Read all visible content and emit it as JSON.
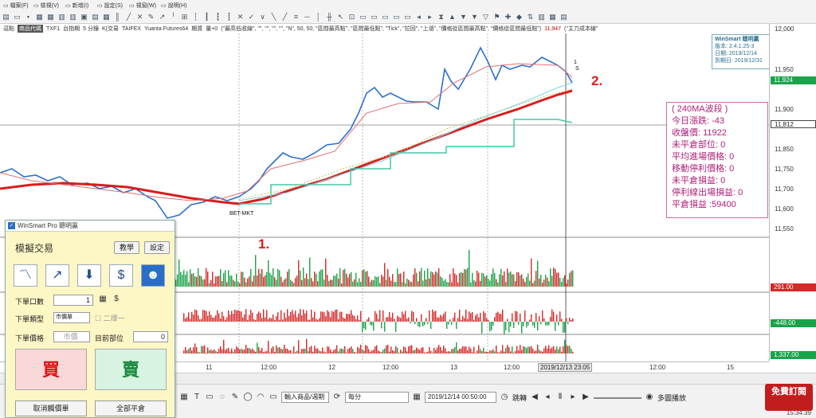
{
  "menu": [
    {
      "label": "檔案(F)",
      "icon": "file-icon"
    },
    {
      "label": "檢視(V)",
      "icon": "view-icon"
    },
    {
      "label": "新增(I)",
      "icon": "new-icon"
    },
    {
      "label": "設定(S)",
      "icon": "settings-icon"
    },
    {
      "label": "視窗(W)",
      "icon": "window-icon"
    },
    {
      "label": "說明(H)",
      "icon": "help-icon"
    }
  ],
  "infobar": {
    "prefix": "逗點",
    "chip": "商品代碼",
    "symbol": "TXF1",
    "exchange": "台指期",
    "period": "5 分鐘",
    "chart_type": "K(交易",
    "exchange_code": "TAIFEX",
    "source": "Yuanta Futures64",
    "contract": "期貨",
    "volume": "量+0",
    "indicators": "(\"最高低收線\", \"\", \"\", \"\", \"\", \"N\", 50, 50, \"區間最高點\", \"區間最低點\", \"Tick\", \"拉回\", \"上漲\", \"價格從區間最高點\", \"價格從區間最低點\")",
    "last": "11,947",
    "extra": "(\"主力成本線\""
  },
  "price_axis": {
    "ticks": [
      "12,000",
      "11,950",
      "11,900",
      "11,850",
      "11,800",
      "11,750",
      "11,700",
      "11,650",
      "11,600",
      "11,550"
    ],
    "flag_last": "11,924",
    "flag_cursor": "11,812",
    "sub1_flag": "291.00",
    "sub2_flag": "-448.00",
    "sub3_flag": "1,337.00"
  },
  "time_axis": {
    "labels": [
      "11",
      "12:00",
      "12",
      "12:00",
      "13",
      "12:00",
      "12:00",
      "15"
    ],
    "cursor": "2019/12/13 23:05"
  },
  "stat_box": {
    "title": "( 240MA波段 )",
    "rows": [
      "今日漲跌: -43",
      "收盤價: 11922",
      "未平倉部位: 0",
      "平均進場價格: 0",
      "移動停利價格: 0",
      "未平倉損益: 0",
      "停利線出場損益: 0",
      "平倉損益 :59400"
    ]
  },
  "ws_box": {
    "title": "WinSmart 聰明贏",
    "lines": [
      "版本: 2.4.1.25-3",
      "日期: 2019/12/14",
      "到期日: 2019/12/31"
    ]
  },
  "annotations": {
    "a1": "1.",
    "a2": "2."
  },
  "chart_labels": {
    "entry": "BET-MKT",
    "marker": "1",
    "marker2": "S"
  },
  "trade_window": {
    "title": "WinSmart Pro 聰明贏",
    "heading": "模擬交易",
    "btn_teach": "教學",
    "btn_setting": "設定",
    "icons": [
      "uptrend-chart-icon",
      "rising-chart-icon",
      "down-arrow-chart-icon",
      "moneybag-icon",
      "person-icon"
    ],
    "lots_label": "下單口數",
    "lots_value": "1",
    "type_label": "下單類型",
    "type_value": "市價單",
    "either_label": "二擇一",
    "price_label": "下單價格",
    "price_value": "市價",
    "position_label": "目前部位",
    "position_value": "0",
    "buy": "買",
    "sell": "賣",
    "cancel": "取消觸價單",
    "flat": "全部平倉"
  },
  "bottom_bar": {
    "product_select": "輸入商品/週期",
    "period_select": "每分",
    "datetime": "2019/12/14 00:50:00",
    "jump": "跳轉",
    "multi": "多圖播放",
    "clock": "15:34:39"
  },
  "subscribe": "免費訂閱",
  "colors": {
    "accent_red": "#d91c1c",
    "ma_red": "#d81d1d",
    "up_bar": "#d62828",
    "down_bar": "#1aa34a",
    "price_line": "#2e6fd0",
    "stat": "#b0217a"
  }
}
